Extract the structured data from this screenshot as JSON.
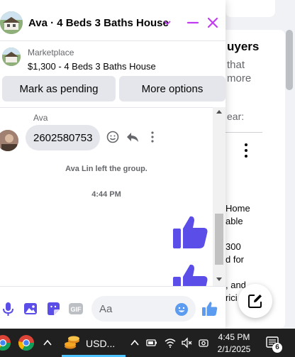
{
  "background": {
    "heading": "uyers",
    "subtext": "that\nmore",
    "ear_text": "ear:",
    "description": "Home\nable\n\n300\nd for\n\n, and\nrici"
  },
  "chat": {
    "title": "Ava · 4 Beds 3 Baths House",
    "marketplace_label": "Marketplace",
    "listing": "$1,300 - 4 Beds 3 Baths House",
    "buttons": {
      "mark_pending": "Mark as pending",
      "more_options": "More options"
    },
    "sender_name": "Ava",
    "message_text": "2602580753",
    "system_note": "Ava Lin left the group.",
    "timestamp": "4:44 PM",
    "composer_placeholder": "Aa",
    "accent_color": "#5b4ee8",
    "header_icon_color": "#c03cf0"
  },
  "taskbar": {
    "app_label": "USD...",
    "time": "4:45 PM",
    "date": "2/1/2025",
    "notification_count": "6"
  }
}
